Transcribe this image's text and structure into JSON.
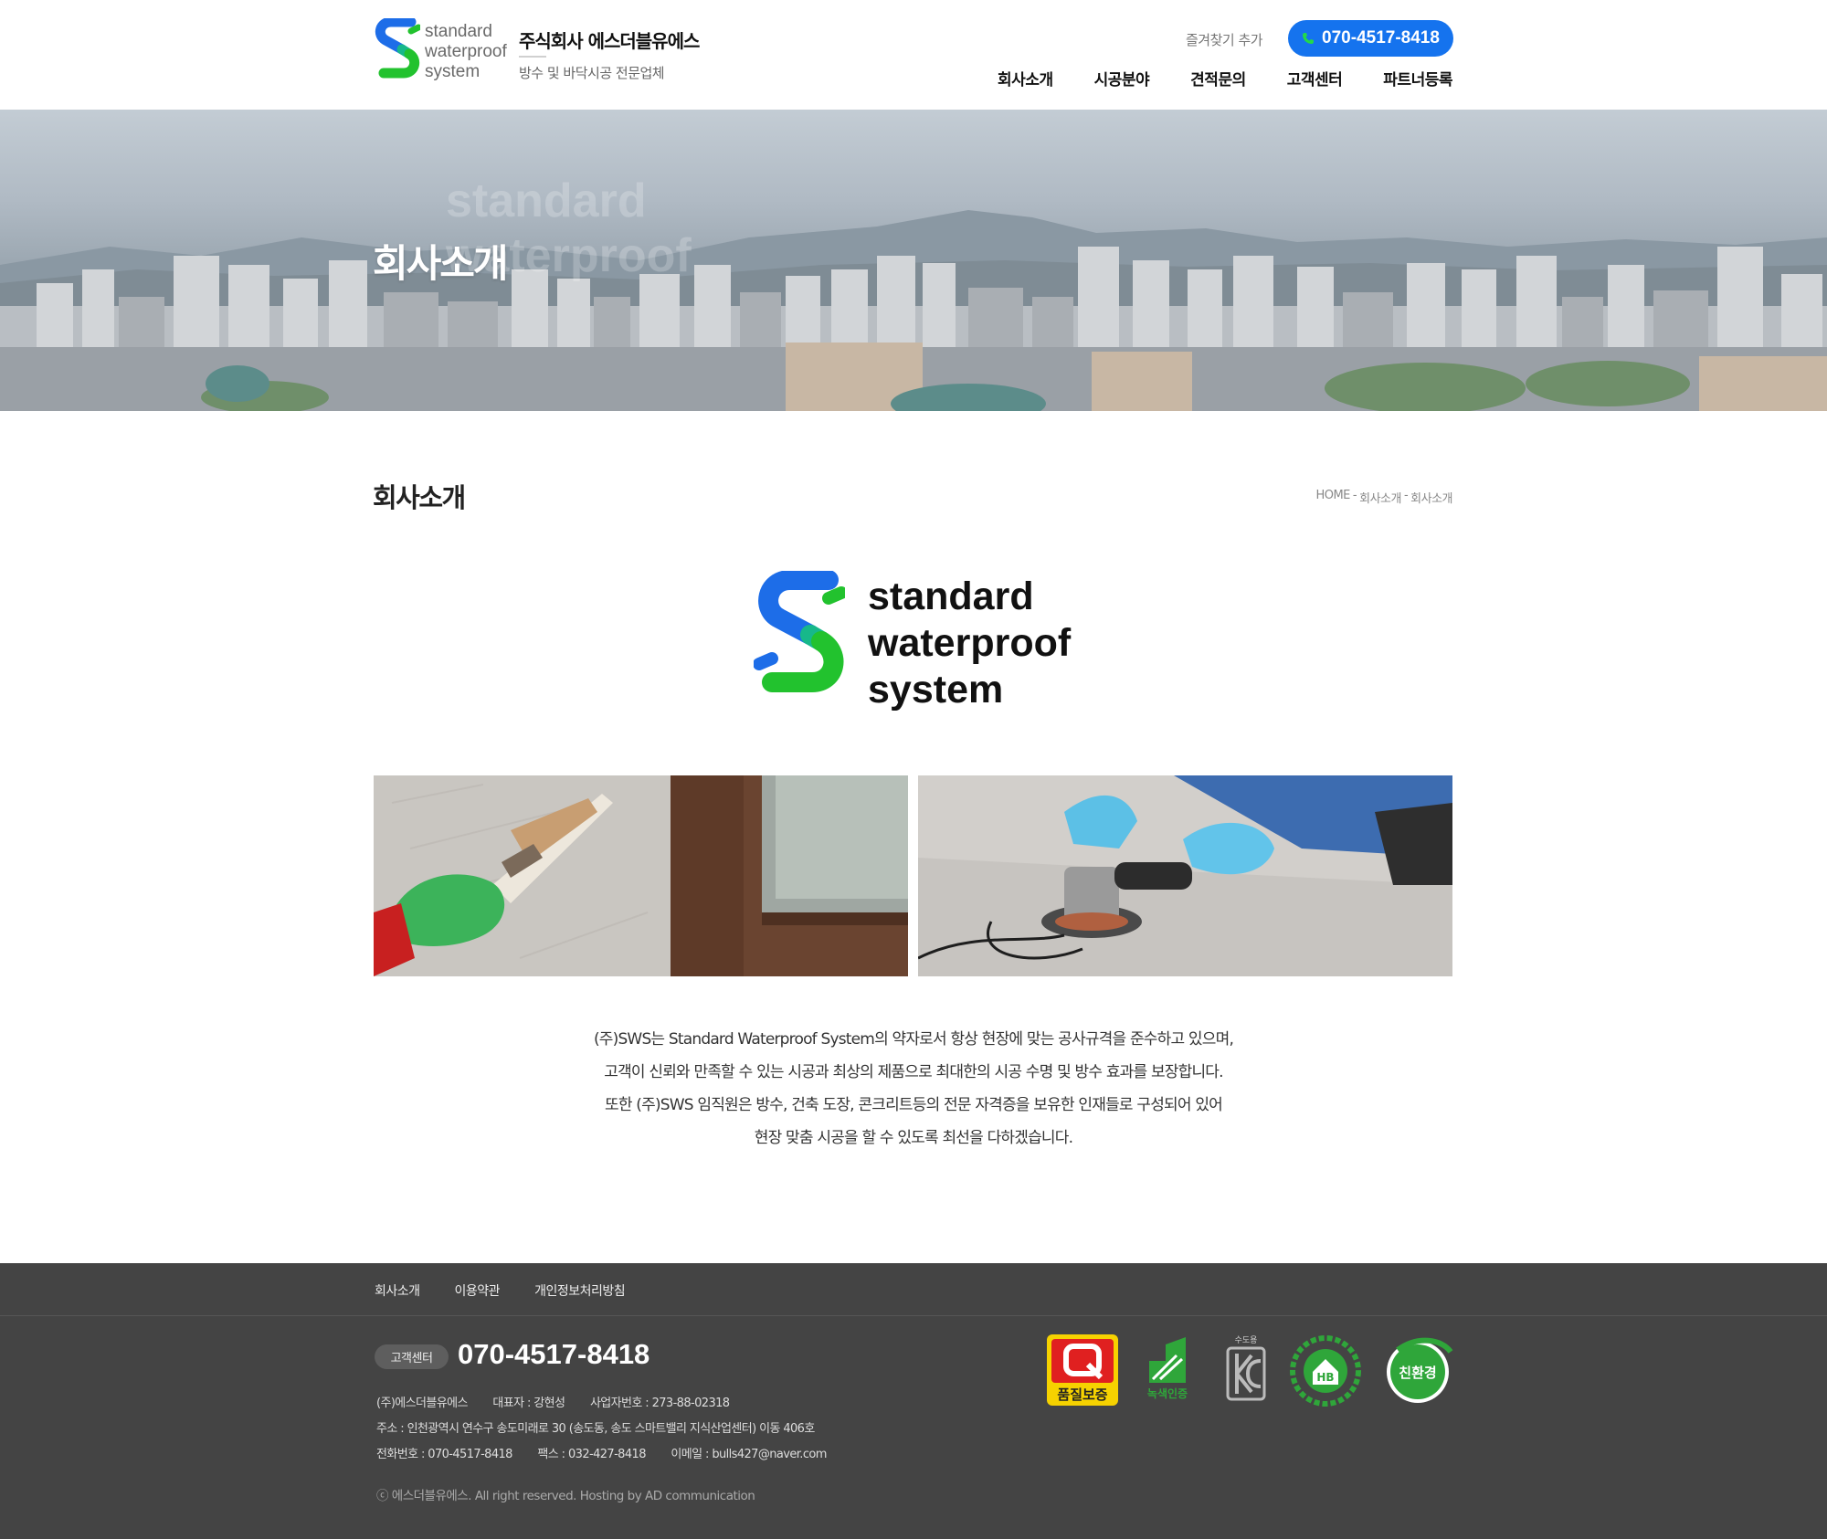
{
  "header": {
    "logo_words": [
      "standard",
      "waterproof",
      "system"
    ],
    "company_name": "주식회사 에스더블유에스",
    "company_desc": "방수 및 바닥시공 전문업체",
    "bookmark_label": "즐겨찾기 추가",
    "phone": "070-4517-8418",
    "nav": [
      "회사소개",
      "시공분야",
      "견적문의",
      "고객센터",
      "파트너등록"
    ]
  },
  "hero": {
    "title": "회사소개",
    "watermark": [
      "standard",
      "waterproof"
    ]
  },
  "content": {
    "page_title": "회사소개",
    "breadcrumb": [
      "HOME",
      "회사소개",
      "회사소개"
    ],
    "brand_words": [
      "standard",
      "waterproof",
      "system"
    ],
    "intro_lines": [
      "(주)SWS는 Standard Waterproof System의 약자로서 항상 현장에 맞는 공사규격을 준수하고 있으며,",
      "고객이 신뢰와 만족할 수 있는 시공과 최상의 제품으로 최대한의 시공 수명 및 방수 효과를 보장합니다.",
      "또한 (주)SWS 임직원은 방수, 건축 도장, 콘크리트등의 전문 자격증을 보유한 인재들로 구성되어 있어",
      "현장 맞춤 시공을 할 수 있도록 최선을 다하겠습니다."
    ]
  },
  "footer": {
    "nav": [
      "회사소개",
      "이용약관",
      "개인정보처리방침"
    ],
    "cs_label": "고객센터",
    "cs_phone": "070-4517-8418",
    "info_rows": [
      [
        "(주)에스더블유에스",
        "대표자 : 강현성",
        "사업자번호 : 273-88-02318"
      ],
      [
        "주소 : 인천광역시 연수구 송도미래로 30 (송도동, 송도 스마트밸리 지식산업센터) 이동 406호"
      ],
      [
        "전화번호 : 070-4517-8418",
        "팩스 : 032-427-8418",
        "이메일 : bulls427@naver.com"
      ]
    ],
    "copyright": "ⓒ 에스더블유에스. All right reserved. Hosting by AD communication",
    "certs": [
      {
        "name": "quality-cert",
        "text": "품질보증"
      },
      {
        "name": "green-cert",
        "text": "녹색인증"
      },
      {
        "name": "kc-cert",
        "text": "수도용"
      },
      {
        "name": "healthy-building-cert",
        "text": "HB"
      },
      {
        "name": "eco-cert",
        "text": "친환경"
      }
    ]
  },
  "colors": {
    "accent_blue": "#1573ee",
    "logo_blue": "#1d6de8",
    "logo_green": "#22c22e",
    "footer_bg": "#444444"
  }
}
